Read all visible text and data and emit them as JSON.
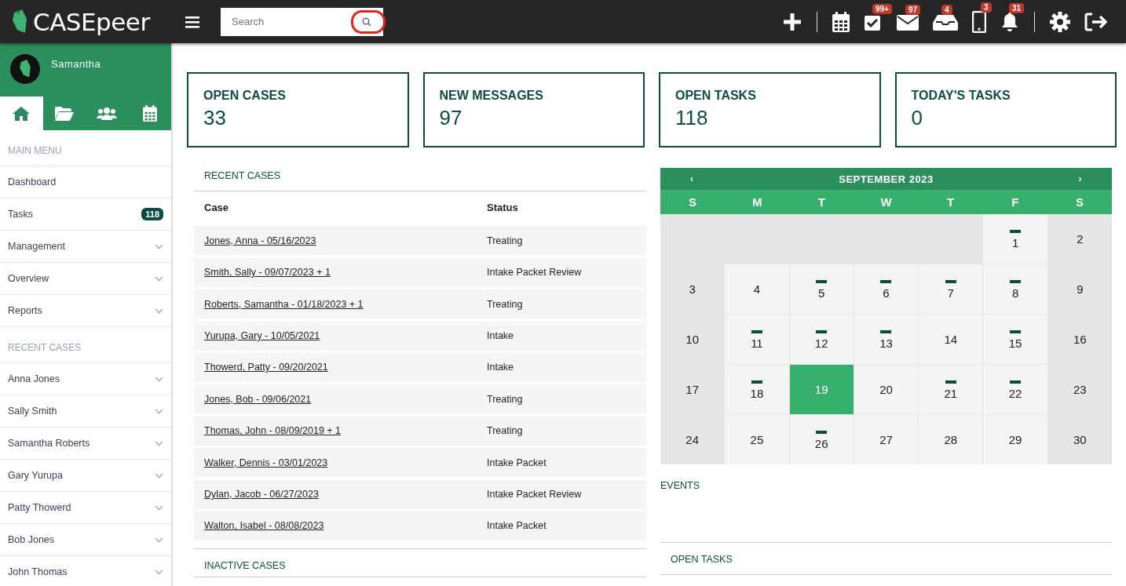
{
  "topbar": {
    "logo": "CASEpeer",
    "search": {
      "placeholder": "Search"
    },
    "icons": [
      {
        "kind": "plus"
      },
      {
        "kind": "divider"
      },
      {
        "kind": "calendar"
      },
      {
        "kind": "tasks",
        "badge": "99+"
      },
      {
        "kind": "mail",
        "badge": "97"
      },
      {
        "kind": "inbox",
        "badge": "4"
      },
      {
        "kind": "phone",
        "badge": "3"
      },
      {
        "kind": "bell",
        "badge": "31"
      },
      {
        "kind": "divider"
      },
      {
        "kind": "gear"
      },
      {
        "kind": "logout"
      }
    ]
  },
  "sidebar": {
    "user": "Samantha",
    "tabs": [
      {
        "kind": "home",
        "selected": true
      },
      {
        "kind": "folder",
        "selected": false
      },
      {
        "kind": "people",
        "selected": false
      },
      {
        "kind": "calendar",
        "selected": false
      }
    ],
    "sections": [
      {
        "title": "MAIN MENU",
        "items": [
          {
            "label": "Dashboard",
            "expandable": false
          },
          {
            "label": "Tasks",
            "badge": "118",
            "expandable": false
          },
          {
            "label": "Management",
            "expandable": true
          },
          {
            "label": "Overview",
            "expandable": true
          },
          {
            "label": "Reports",
            "expandable": true
          }
        ]
      },
      {
        "title": "RECENT CASES",
        "items": [
          {
            "label": "Anna Jones",
            "expandable": true
          },
          {
            "label": "Sally Smith",
            "expandable": true
          },
          {
            "label": "Samantha Roberts",
            "expandable": true
          },
          {
            "label": "Gary Yurupa",
            "expandable": true
          },
          {
            "label": "Patty Thowerd",
            "expandable": true
          },
          {
            "label": "Bob Jones",
            "expandable": true
          },
          {
            "label": "John Thomas",
            "expandable": true
          }
        ]
      }
    ]
  },
  "stats": [
    {
      "label": "OPEN CASES",
      "value": "33"
    },
    {
      "label": "NEW MESSAGES",
      "value": "97"
    },
    {
      "label": "OPEN TASKS",
      "value": "118"
    },
    {
      "label": "TODAY'S TASKS",
      "value": "0"
    }
  ],
  "recent_cases": {
    "title": "RECENT CASES",
    "columns": [
      "Case",
      "Status"
    ],
    "rows": [
      {
        "case": "Jones, Anna - 05/16/2023",
        "status": "Treating"
      },
      {
        "case": "Smith, Sally - 09/07/2023 + 1",
        "status": "Intake Packet Review"
      },
      {
        "case": "Roberts, Samantha - 01/18/2023 + 1",
        "status": "Treating"
      },
      {
        "case": "Yurupa, Gary - 10/05/2021",
        "status": "Intake"
      },
      {
        "case": "Thowerd, Patty - 09/20/2021",
        "status": "Intake"
      },
      {
        "case": "Jones, Bob - 09/06/2021",
        "status": "Treating"
      },
      {
        "case": "Thomas, John - 08/09/2019 + 1",
        "status": "Treating"
      },
      {
        "case": "Walker, Dennis - 03/01/2023",
        "status": "Intake Packet"
      },
      {
        "case": "Dylan, Jacob - 06/27/2023",
        "status": "Intake Packet Review"
      },
      {
        "case": "Walton, Isabel - 08/08/2023",
        "status": "Intake Packet"
      }
    ]
  },
  "inactive_cases": {
    "title": "INACTIVE CASES"
  },
  "calendar": {
    "prev": "‹",
    "title": "SEPTEMBER 2023",
    "next": "›",
    "weekdays": [
      "S",
      "M",
      "T",
      "W",
      "T",
      "F",
      "S"
    ],
    "days": [
      {
        "day": "1",
        "event": true,
        "selected": false
      },
      {
        "day": "2",
        "event": false,
        "selected": false
      },
      {
        "day": "3",
        "event": false,
        "selected": false
      },
      {
        "day": "4",
        "event": false,
        "selected": false
      },
      {
        "day": "5",
        "event": true,
        "selected": false
      },
      {
        "day": "6",
        "event": true,
        "selected": false
      },
      {
        "day": "7",
        "event": true,
        "selected": false
      },
      {
        "day": "8",
        "event": true,
        "selected": false
      },
      {
        "day": "9",
        "event": false,
        "selected": false
      },
      {
        "day": "10",
        "event": false,
        "selected": false
      },
      {
        "day": "11",
        "event": true,
        "selected": false
      },
      {
        "day": "12",
        "event": true,
        "selected": false
      },
      {
        "day": "13",
        "event": true,
        "selected": false
      },
      {
        "day": "14",
        "event": false,
        "selected": false
      },
      {
        "day": "15",
        "event": true,
        "selected": false
      },
      {
        "day": "16",
        "event": false,
        "selected": false
      },
      {
        "day": "17",
        "event": false,
        "selected": false
      },
      {
        "day": "18",
        "event": true,
        "selected": false
      },
      {
        "day": "19",
        "event": false,
        "selected": true
      },
      {
        "day": "20",
        "event": false,
        "selected": false
      },
      {
        "day": "21",
        "event": true,
        "selected": false
      },
      {
        "day": "22",
        "event": true,
        "selected": false
      },
      {
        "day": "23",
        "event": false,
        "selected": false
      },
      {
        "day": "24",
        "event": false,
        "selected": false
      },
      {
        "day": "25",
        "event": false,
        "selected": false
      },
      {
        "day": "26",
        "event": true,
        "selected": false
      },
      {
        "day": "27",
        "event": false,
        "selected": false
      },
      {
        "day": "28",
        "event": false,
        "selected": false
      },
      {
        "day": "29",
        "event": false,
        "selected": false
      },
      {
        "day": "30",
        "event": false,
        "selected": false
      }
    ]
  },
  "events": {
    "title": "EVENTS"
  },
  "open_tasks": {
    "title": "OPEN TASKS"
  }
}
